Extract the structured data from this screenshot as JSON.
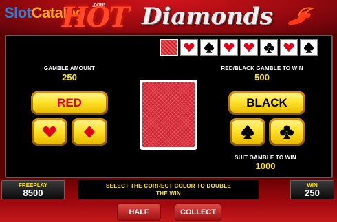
{
  "watermark": {
    "slot": "Slot",
    "catalog": "Catalog",
    "com": ".com"
  },
  "title": {
    "hot": "HOT",
    "diamonds": "Diamonds"
  },
  "history": [
    "back",
    "heart",
    "spade",
    "heart",
    "heart",
    "club",
    "heart",
    "spade"
  ],
  "gamble_amount": {
    "label": "GAMBLE AMOUNT",
    "value": "250"
  },
  "color_gamble": {
    "label": "RED/BLACK GAMBLE TO WIN",
    "value": "500"
  },
  "suit_gamble": {
    "label": "SUIT GAMBLE TO WIN",
    "value": "1000"
  },
  "buttons": {
    "red": "RED",
    "black": "BLACK",
    "half": "HALF",
    "collect": "COLLECT"
  },
  "freeplay": {
    "label": "FREEPLAY",
    "value": "8500"
  },
  "win": {
    "label": "WIN",
    "value": "250"
  },
  "message": {
    "line1": "SELECT THE CORRECT COLOR TO DOUBLE",
    "line2": "THE WIN"
  },
  "colors": {
    "red_suit": "#e0001a",
    "black_suit": "#000000",
    "accent_yellow": "#ffe800"
  }
}
